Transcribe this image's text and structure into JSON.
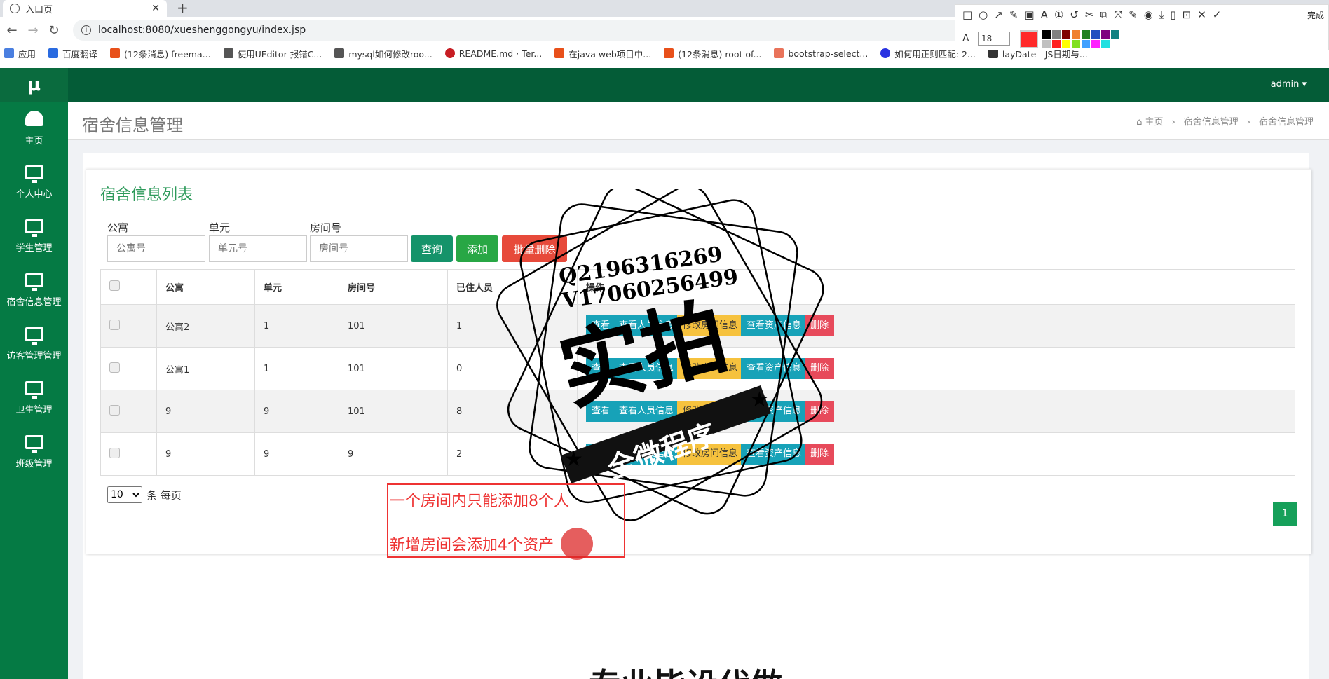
{
  "browser": {
    "tab_title": "入口页",
    "url": "localhost:8080/xueshenggongyu/index.jsp",
    "bookmarks": [
      "应用",
      "百度翻译",
      "(12条消息) freema...",
      "使用UEditor 报错C...",
      "mysql如何修改roo...",
      "README.md · Ter...",
      "在java web项目中...",
      "(12条消息) root of...",
      "bootstrap-select...",
      "如何用正则匹配: 2...",
      "layDate - JS日期与..."
    ]
  },
  "screenshot_tool": {
    "done_label": "完成",
    "font_size": "18",
    "current_color": "#ff2a2a",
    "palette": [
      "#000000",
      "#808080",
      "#800000",
      "#f08030",
      "#208020",
      "#2050c0",
      "#800080",
      "#108080",
      "#ffffff",
      "#c0c0c0",
      "#ff2020",
      "#ffff00",
      "#80e020",
      "#40a0ff",
      "#ff20ff",
      "#20e0e0"
    ]
  },
  "sidebar": {
    "logo": "μ",
    "items": [
      {
        "label": "主页",
        "icon": "dashboard-icon"
      },
      {
        "label": "个人中心",
        "icon": "monitor-icon"
      },
      {
        "label": "学生管理",
        "icon": "monitor-icon"
      },
      {
        "label": "宿舍信息管理",
        "icon": "monitor-icon"
      },
      {
        "label": "访客管理管理",
        "icon": "monitor-icon"
      },
      {
        "label": "卫生管理",
        "icon": "monitor-icon"
      },
      {
        "label": "班级管理",
        "icon": "monitor-icon"
      }
    ]
  },
  "topbar": {
    "user": "admin ▾"
  },
  "header": {
    "title": "宿舍信息管理",
    "breadcrumb": [
      "主页",
      "宿舍信息管理",
      "宿舍信息管理"
    ]
  },
  "card": {
    "title": "宿舍信息列表",
    "filters": [
      {
        "label": "公寓",
        "placeholder": "公寓号"
      },
      {
        "label": "单元",
        "placeholder": "单元号"
      },
      {
        "label": "房间号",
        "placeholder": "房间号"
      }
    ],
    "buttons": {
      "search": "查询",
      "add": "添加",
      "batch_delete": "批量删除"
    },
    "columns": [
      "公寓",
      "单元",
      "房间号",
      "已住人员",
      "操作"
    ],
    "rows": [
      [
        "公寓2",
        "1",
        "101",
        "1"
      ],
      [
        "公寓1",
        "1",
        "101",
        "0"
      ],
      [
        "9",
        "9",
        "101",
        "8"
      ],
      [
        "9",
        "9",
        "9",
        "2"
      ]
    ],
    "actions": [
      "查看",
      "查看人员信息",
      "修改房间信息",
      "查看资产信息",
      "删除"
    ],
    "per_page_value": "10",
    "per_page_suffix": "条 每页",
    "page": "1"
  },
  "annotation": {
    "line1": "一个房间内只能添加8个人",
    "line2": "新增房间会添加4个资产"
  },
  "watermark": {
    "qq": "Q2196316269",
    "wechat": "V17060256499",
    "big": "实拍",
    "banner": "全微程序"
  },
  "bottom_text": "专业毕设代做"
}
